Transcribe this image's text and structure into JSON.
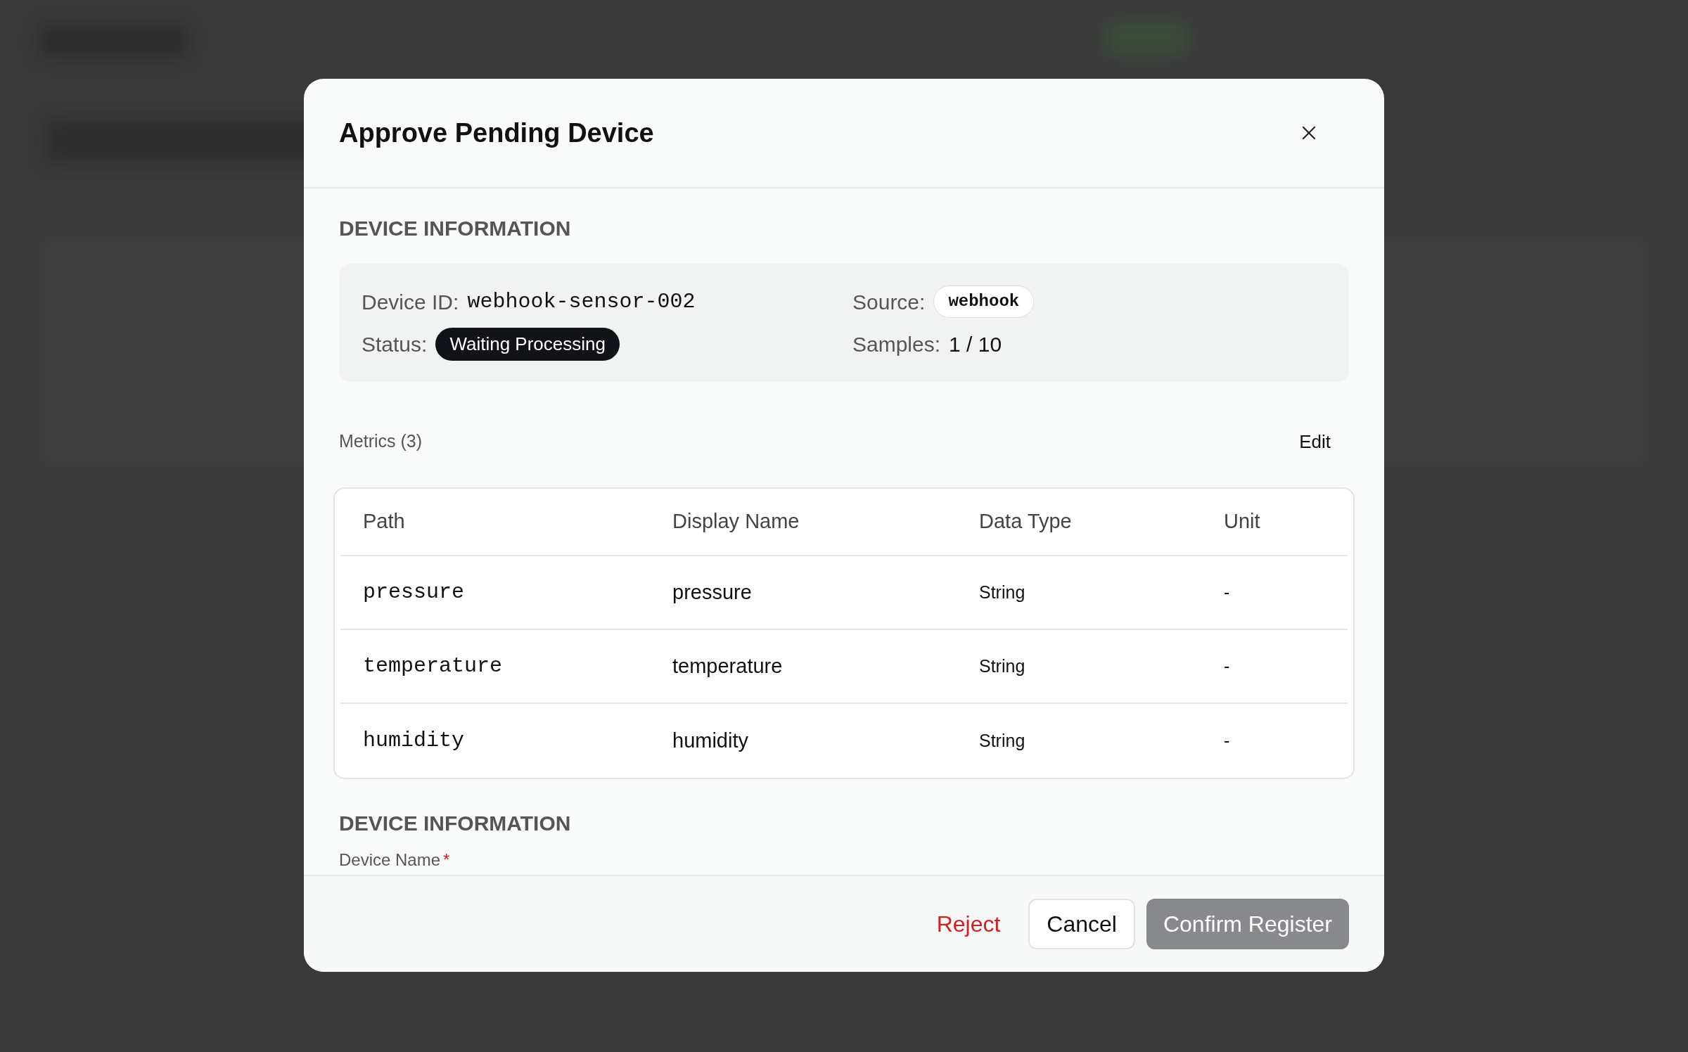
{
  "dialog": {
    "title": "Approve Pending Device",
    "device_section": {
      "heading": "DEVICE INFORMATION",
      "fields": [
        {
          "kind": "mono",
          "label": "Device ID:",
          "value": "webhook-sensor-002"
        },
        {
          "kind": "tag",
          "label": "Source:",
          "value": "webhook"
        },
        {
          "kind": "pill",
          "label": "Status:",
          "value": "Waiting Processing"
        },
        {
          "kind": "plain",
          "label": "Samples:",
          "value": "1 / 10"
        }
      ]
    },
    "metrics": {
      "label": "Metrics (3)",
      "edit_button": "Edit",
      "columns": [
        "Path",
        "Display Name",
        "Data Type",
        "Unit"
      ],
      "rows": [
        [
          "pressure",
          "pressure",
          "String",
          "-"
        ],
        [
          "temperature",
          "temperature",
          "String",
          "-"
        ],
        [
          "humidity",
          "humidity",
          "String",
          "-"
        ]
      ]
    },
    "form_section": {
      "heading": "DEVICE INFORMATION",
      "field_label": "Device Name",
      "required_mark": "*"
    },
    "buttons": [
      {
        "kind": "danger",
        "label": "Reject"
      },
      {
        "kind": "outline",
        "label": "Cancel"
      },
      {
        "kind": "primary",
        "label": "Confirm Register",
        "disabled": true
      }
    ]
  }
}
